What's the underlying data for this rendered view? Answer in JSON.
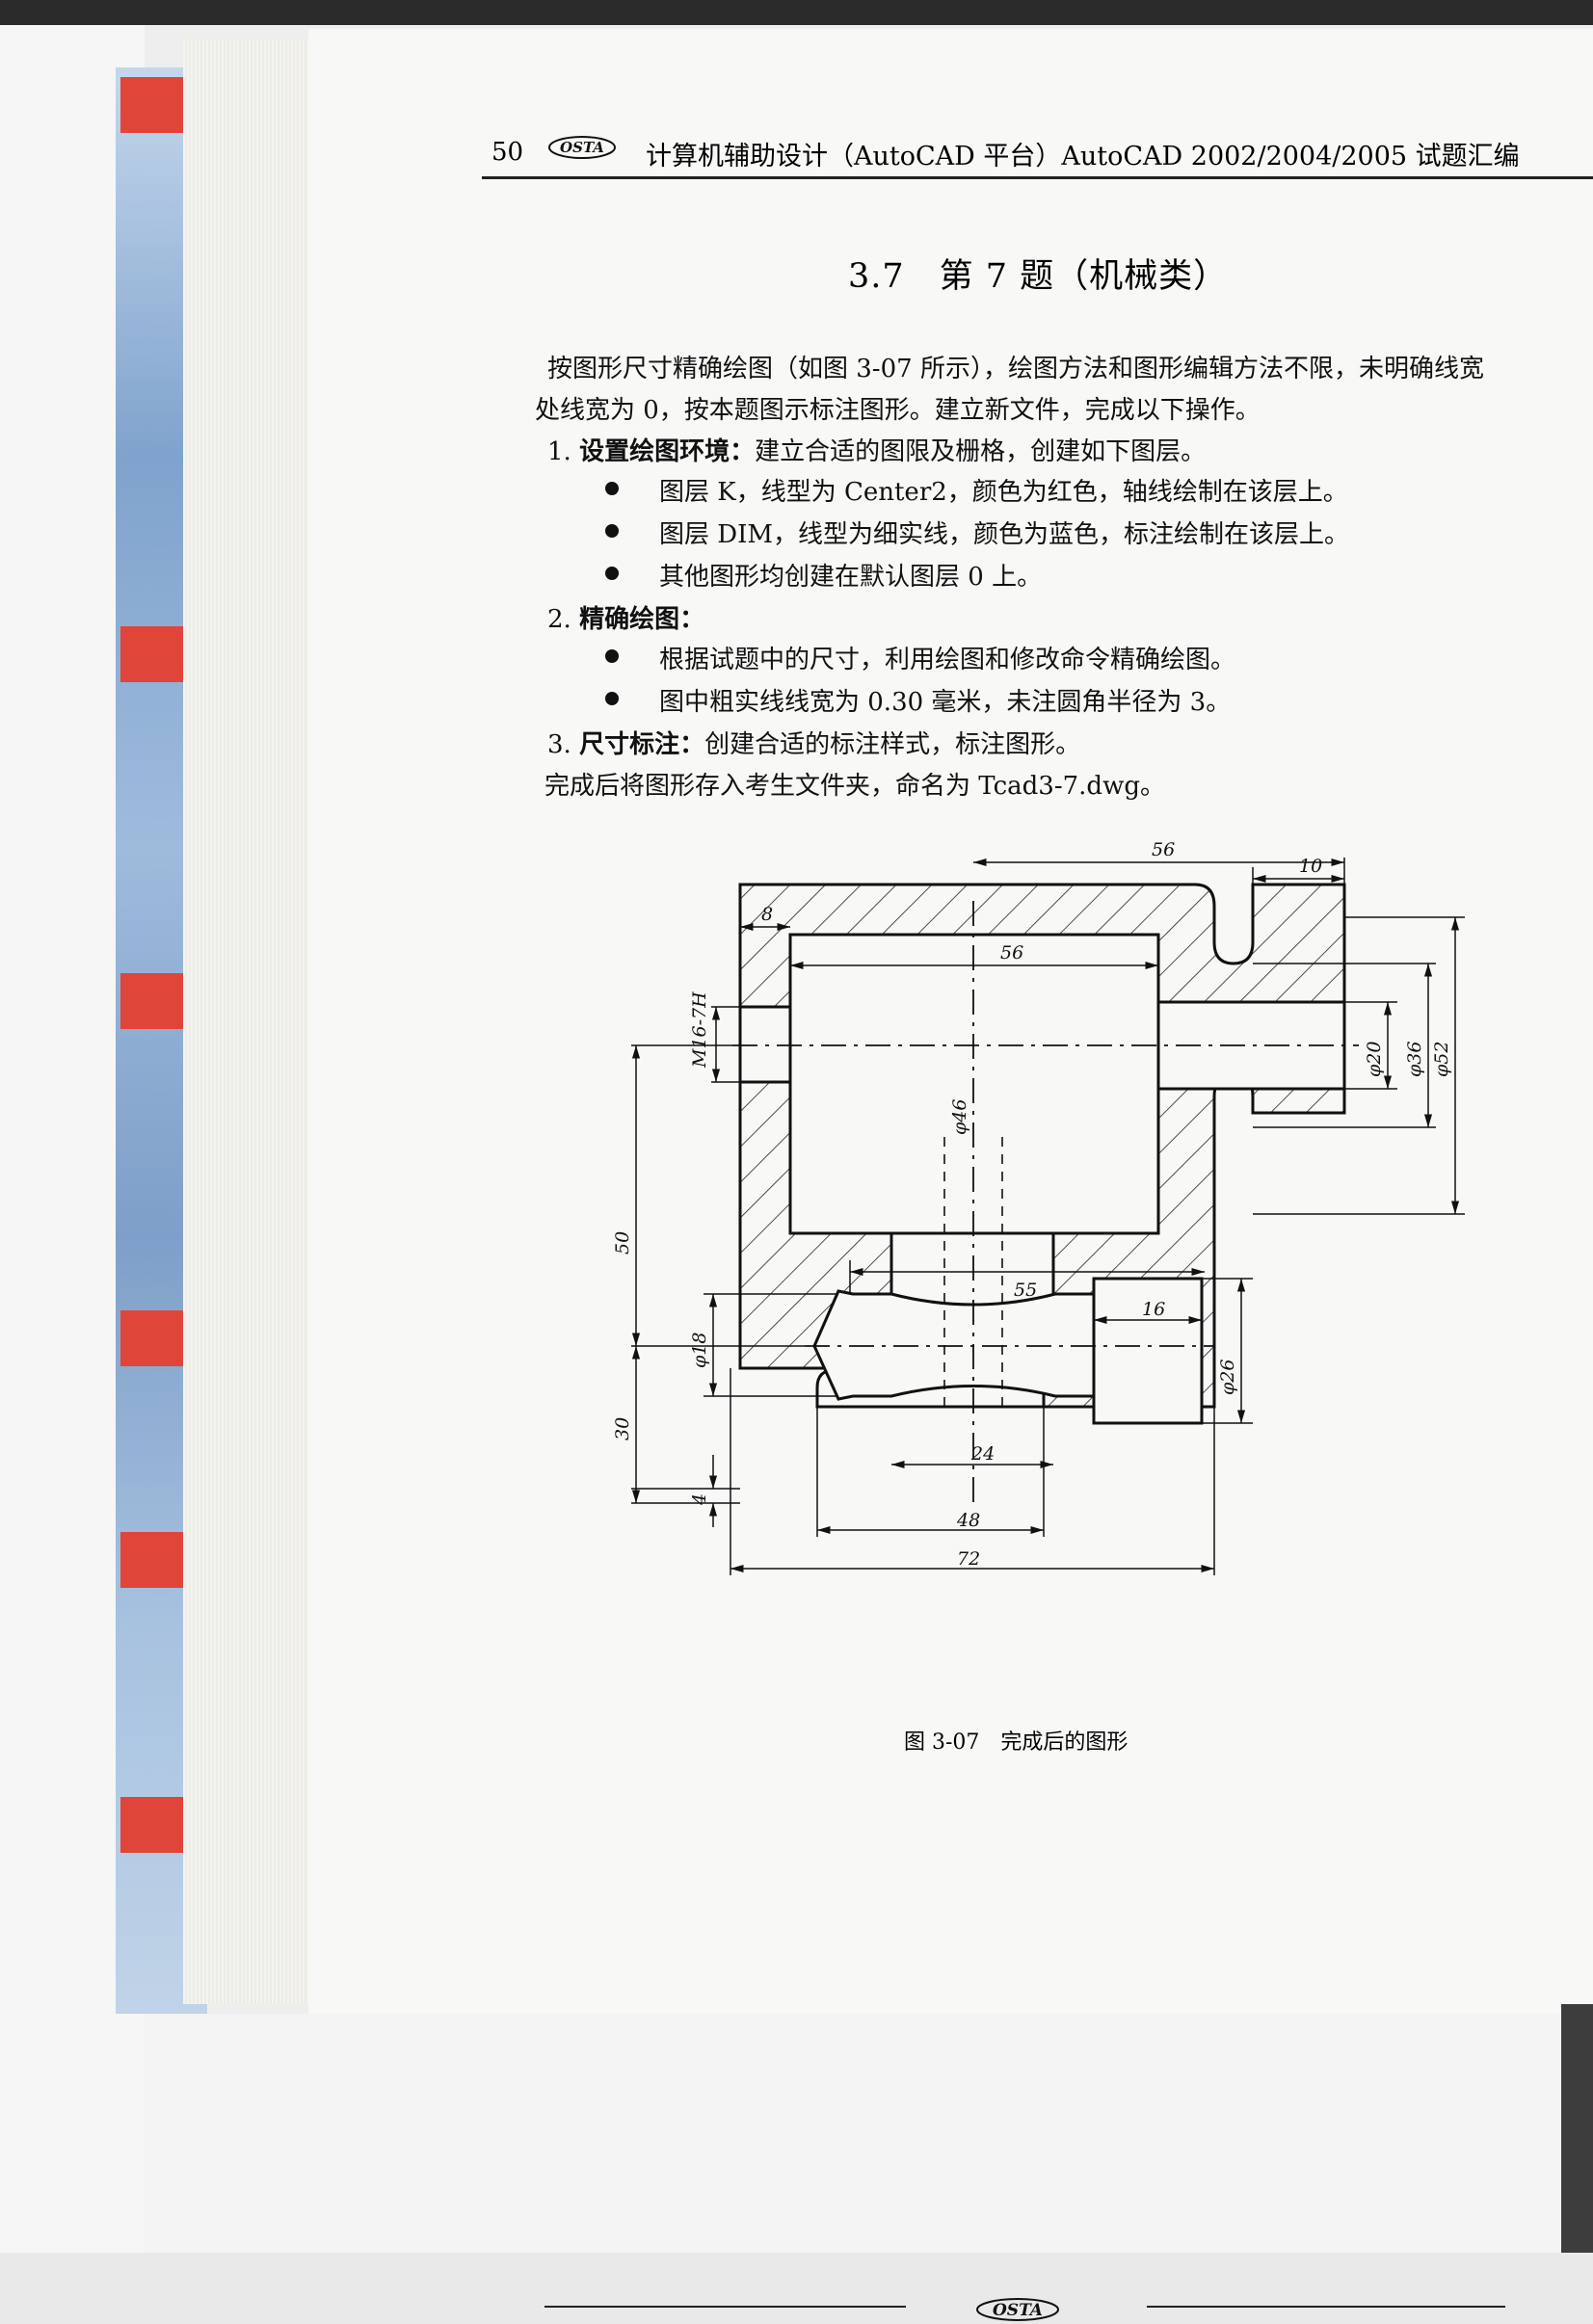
{
  "header": {
    "page_number": "50",
    "logo_text": "OSTA",
    "title": "计算机辅助设计（AutoCAD 平台）AutoCAD 2002/2004/2005 试题汇编"
  },
  "section": {
    "title": "3.7　第 7 题（机械类）"
  },
  "body": {
    "intro_line1": "按图形尺寸精确绘图（如图 3-07 所示），绘图方法和图形编辑方法不限，未明确线宽",
    "intro_line2": "处线宽为 0，按本题图示标注图形。建立新文件，完成以下操作。",
    "step1_num": "1.",
    "step1_head": "设置绘图环境：",
    "step1_text": "建立合适的图限及栅格，创建如下图层。",
    "step1_bullets": [
      "图层 K，线型为 Center2，颜色为红色，轴线绘制在该层上。",
      "图层 DIM，线型为细实线，颜色为蓝色，标注绘制在该层上。",
      "其他图形均创建在默认图层 0 上。"
    ],
    "step2_num": "2.",
    "step2_head": "精确绘图：",
    "step2_bullets": [
      "根据试题中的尺寸，利用绘图和修改命令精确绘图。",
      "图中粗实线线宽为 0.30 毫米，未注圆角半径为 3。"
    ],
    "step3_num": "3.",
    "step3_head": "尺寸标注：",
    "step3_text": "创建合适的标注样式，标注图形。",
    "final": "完成后将图形存入考生文件夹，命名为 Tcad3-7.dwg。"
  },
  "figure": {
    "dims": {
      "top56": "56",
      "top10": "10",
      "d8": "8",
      "inner56": "56",
      "m16": "M16-7H",
      "phi46": "φ46",
      "phi20": "φ20",
      "phi36": "φ36",
      "phi52": "φ52",
      "v50": "50",
      "h55": "55",
      "phi18": "φ18",
      "h16": "16",
      "phi26": "φ26",
      "v30": "30",
      "h24": "24",
      "v4": "4",
      "h48": "48",
      "h72": "72"
    },
    "caption": "图 3-07　完成后的图形"
  },
  "footer": {
    "logo_text": "OSTA"
  }
}
